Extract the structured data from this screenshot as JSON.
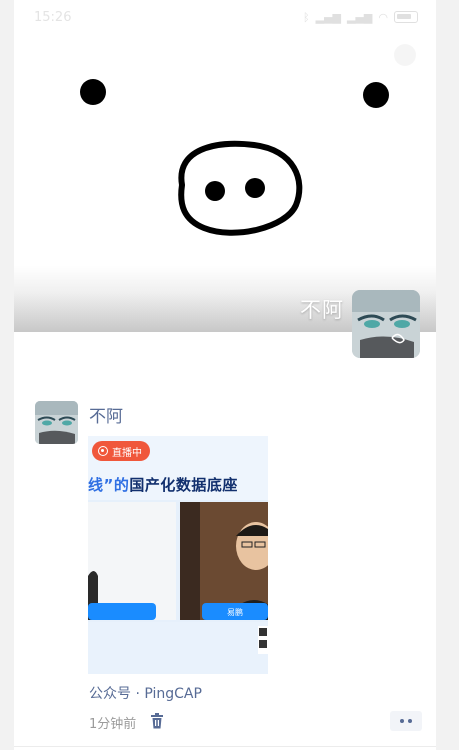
{
  "status_bar": {
    "time": "15:26",
    "icons": [
      "bluetooth-icon",
      "signal-icon",
      "signal-icon",
      "wifi-icon",
      "battery-icon"
    ]
  },
  "profile": {
    "name": "不阿",
    "cover": "pig-face-drawing"
  },
  "post": {
    "author": "不阿",
    "share_card": {
      "live_badge": "直播中",
      "headline_accent": "线”的",
      "headline_rest": "国产化数据底座",
      "host_right": "易鹏"
    },
    "source": "公众号 · PingCAP",
    "time": "1分钟前",
    "delete_icon": "trash-icon",
    "more_icon": "more-dots-icon"
  },
  "colors": {
    "link": "#576b95",
    "live_badge": "#f0573b",
    "label_blue": "#1a8cff",
    "meta_gray": "#9b9b9b"
  }
}
